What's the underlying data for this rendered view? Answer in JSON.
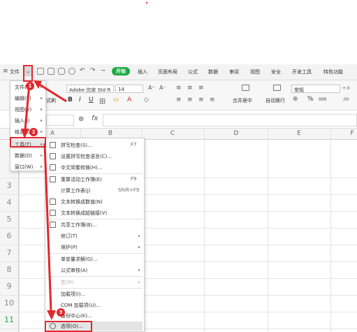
{
  "tabs": {
    "file": "文件",
    "start": "开始",
    "insert": "插入",
    "page_layout": "页面布局",
    "formula": "公式",
    "data": "数据",
    "review": "审阅",
    "view": "视图",
    "security": "安全",
    "dev_tools": "开发工具",
    "special": "特色功能"
  },
  "ribbon": {
    "format_painter": "式刷",
    "font_name": "Adobe 仿宋 Std R",
    "font_size": "14",
    "merge_center": "合并居中",
    "wrap_text": "自动换行",
    "number_format": "常规",
    "percent": "%",
    "zero_label": "000"
  },
  "formula_bar": {
    "fx": "fx"
  },
  "columns": [
    "A",
    "B",
    "C",
    "D",
    "E",
    "F"
  ],
  "rows": [
    "3",
    "4",
    "5",
    "6",
    "7",
    "8",
    "9",
    "10",
    "11"
  ],
  "main_menu": {
    "items": [
      {
        "label": "文件(F)"
      },
      {
        "label": "编辑(E)"
      },
      {
        "label": "视图(V)"
      },
      {
        "label": "插入(I)"
      },
      {
        "label": "格式(O)"
      },
      {
        "label": "工具(T)"
      },
      {
        "label": "数据(D)"
      },
      {
        "label": "窗口(W)"
      }
    ]
  },
  "tools_menu": {
    "items": [
      {
        "label": "拼写检查(S)...",
        "shortcut": "F7"
      },
      {
        "label": "设置拼写检查语言(C)...",
        "shortcut": ""
      },
      {
        "label": "中文简繁转换(H)...",
        "shortcut": ""
      },
      {
        "label": "重算活动工作簿(E)",
        "shortcut": "F9"
      },
      {
        "label": "计算工作表(J)",
        "shortcut": "Shift+F9"
      },
      {
        "label": "文本转换成数值(N)",
        "shortcut": ""
      },
      {
        "label": "文本转换成超链接(V)",
        "shortcut": ""
      },
      {
        "label": "共享工作簿(B)...",
        "shortcut": ""
      },
      {
        "label": "修订(T)",
        "shortcut": ""
      },
      {
        "label": "保护(P)",
        "shortcut": ""
      },
      {
        "label": "单变量求解(G)...",
        "shortcut": ""
      },
      {
        "label": "公式审核(A)",
        "shortcut": ""
      },
      {
        "label": "宏(M)",
        "shortcut": ""
      },
      {
        "label": "加载项(I)...",
        "shortcut": ""
      },
      {
        "label": "COM 加载项(U)...",
        "shortcut": ""
      },
      {
        "label": "备份中心(K)...",
        "shortcut": ""
      },
      {
        "label": "选项(O)...",
        "shortcut": ""
      }
    ]
  },
  "badges": [
    "1",
    "2",
    "3"
  ],
  "colors": {
    "accent_green": "#1eaa45",
    "annotation_red": "#e2262b"
  }
}
